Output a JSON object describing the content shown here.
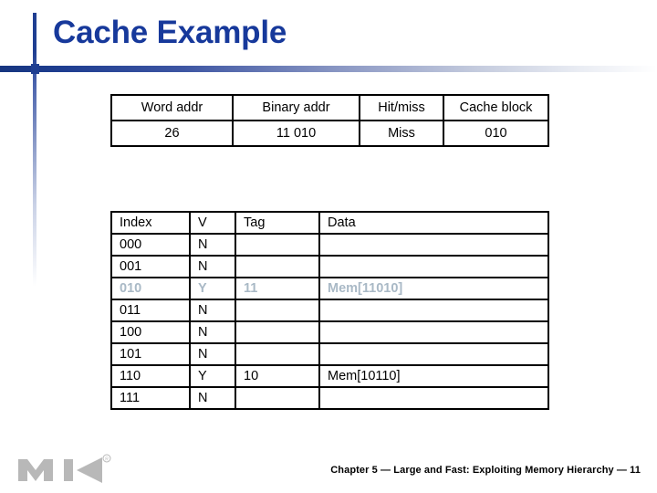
{
  "slide": {
    "title": "Cache Example",
    "footer": "Chapter 5 — Large and Fast: Exploiting Memory Hierarchy — 11",
    "logo_alt": "MK",
    "logo_registered": "®",
    "accent_color": "#17399b",
    "rule_color": "#1f3e91",
    "highlight_color": "#a9b9c6",
    "logo_color": "#b8b8b8"
  },
  "access_table": {
    "headers": [
      "Word addr",
      "Binary addr",
      "Hit/miss",
      "Cache block"
    ],
    "rows": [
      [
        "26",
        "11 010",
        "Miss",
        "010"
      ]
    ]
  },
  "cache_table": {
    "headers": [
      "Index",
      "V",
      "Tag",
      "Data"
    ],
    "rows": [
      {
        "index": "000",
        "v": "N",
        "tag": "",
        "data": "",
        "highlight": false
      },
      {
        "index": "001",
        "v": "N",
        "tag": "",
        "data": "",
        "highlight": false
      },
      {
        "index": "010",
        "v": "Y",
        "tag": "11",
        "data": "Mem[11010]",
        "highlight": true
      },
      {
        "index": "011",
        "v": "N",
        "tag": "",
        "data": "",
        "highlight": false
      },
      {
        "index": "100",
        "v": "N",
        "tag": "",
        "data": "",
        "highlight": false
      },
      {
        "index": "101",
        "v": "N",
        "tag": "",
        "data": "",
        "highlight": false
      },
      {
        "index": "110",
        "v": "Y",
        "tag": "10",
        "data": "Mem[10110]",
        "highlight": false
      },
      {
        "index": "111",
        "v": "N",
        "tag": "",
        "data": "",
        "highlight": false
      }
    ]
  }
}
